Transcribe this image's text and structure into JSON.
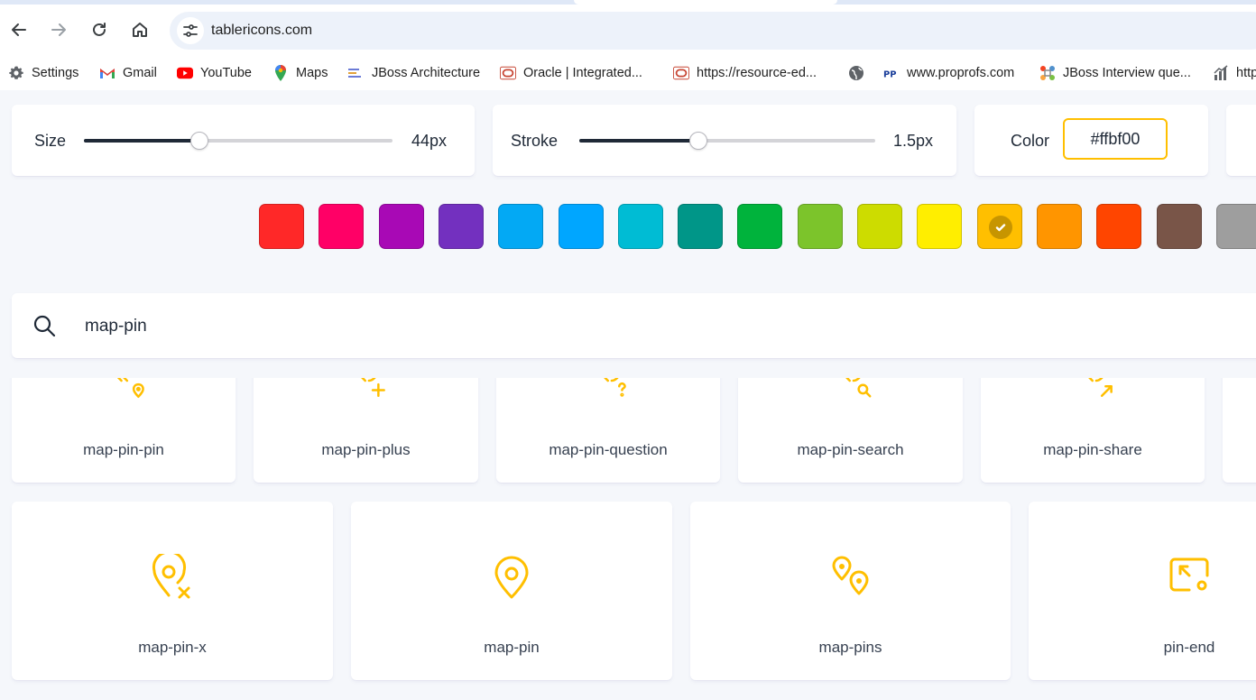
{
  "browser": {
    "url": "tablericons.com",
    "bookmarks": [
      {
        "label": "Settings",
        "icon": "gear-icon"
      },
      {
        "label": "Gmail",
        "icon": "gmail-icon"
      },
      {
        "label": "YouTube",
        "icon": "youtube-icon"
      },
      {
        "label": "Maps",
        "icon": "maps-icon"
      },
      {
        "label": "JBoss Architecture",
        "icon": "jboss-icon"
      },
      {
        "label": "Oracle | Integrated...",
        "icon": "oracle-icon"
      },
      {
        "label": "https://resource-ed...",
        "icon": "oracle-icon"
      },
      {
        "label": "",
        "icon": "globe-icon"
      },
      {
        "label": "www.proprofs.com",
        "icon": "proprofs-icon"
      },
      {
        "label": "JBoss Interview que...",
        "icon": "joomla-icon"
      },
      {
        "label": "http",
        "icon": "chart-icon"
      }
    ]
  },
  "controls": {
    "size": {
      "label": "Size",
      "value": "44px",
      "fraction": 0.37
    },
    "stroke": {
      "label": "Stroke",
      "value": "1.5px",
      "fraction": 0.4
    },
    "color": {
      "label": "Color",
      "value": "#ffbf00"
    }
  },
  "swatches": [
    {
      "color": "#ff2828",
      "selected": false
    },
    {
      "color": "#ff0066",
      "selected": false
    },
    {
      "color": "#a809b5",
      "selected": false
    },
    {
      "color": "#7330bf",
      "selected": false
    },
    {
      "color": "#03a9f4",
      "selected": false
    },
    {
      "color": "#00a6ff",
      "selected": false
    },
    {
      "color": "#00bcd4",
      "selected": false
    },
    {
      "color": "#009688",
      "selected": false
    },
    {
      "color": "#00b33c",
      "selected": false
    },
    {
      "color": "#7cc42b",
      "selected": false
    },
    {
      "color": "#cddc00",
      "selected": false
    },
    {
      "color": "#ffee00",
      "selected": false
    },
    {
      "color": "#ffbf00",
      "selected": true
    },
    {
      "color": "#ff9500",
      "selected": false
    },
    {
      "color": "#ff4500",
      "selected": false
    },
    {
      "color": "#795548",
      "selected": false
    },
    {
      "color": "#9e9e9e",
      "selected": false
    }
  ],
  "search": {
    "query": "map-pin"
  },
  "icons_row1": [
    "map-pin-pin",
    "map-pin-plus",
    "map-pin-question",
    "map-pin-search",
    "map-pin-share"
  ],
  "icons_row2": [
    "map-pin-x",
    "map-pin",
    "map-pins",
    "pin-end"
  ],
  "accent": "#ffbf00"
}
